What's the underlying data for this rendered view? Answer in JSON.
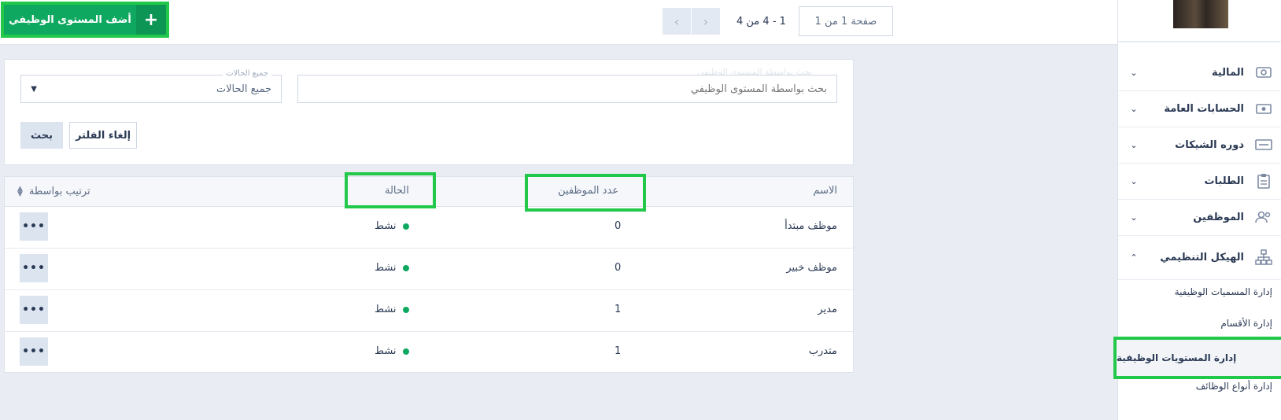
{
  "header": {
    "add_button_label": "أضف المستوى الوظيفي",
    "add_button_icon": "+",
    "pager": {
      "range_text": "1 - 4 من 4",
      "page_box_text": "صفحة 1 من 1",
      "prev_glyph": "‹",
      "next_glyph": "›"
    }
  },
  "filters": {
    "search_placeholder": "بحث بواسطة المستوى الوظيفي",
    "status_legend": "جميع الحالات",
    "status_value": "جميع الحالات",
    "search_button": "بحث",
    "clear_button": "إلغاء الفلتر"
  },
  "table": {
    "headers": {
      "name": "الاسم",
      "employees": "عدد الموظفين",
      "status": "الحالة",
      "sort": "ترتيب بواسطة"
    },
    "rows": [
      {
        "name": "موظف مبتدأ",
        "employees": "0",
        "status": "نشط"
      },
      {
        "name": "موظف خبير",
        "employees": "0",
        "status": "نشط"
      },
      {
        "name": "مدير",
        "employees": "1",
        "status": "نشط"
      },
      {
        "name": "متدرب",
        "employees": "1",
        "status": "نشط"
      }
    ],
    "more_glyph": "•••"
  },
  "sidebar": {
    "items": [
      {
        "label": "المالية",
        "icon": "money-icon",
        "chevron": "⌄"
      },
      {
        "label": "الحسابات العامة",
        "icon": "cash-icon",
        "chevron": "⌄"
      },
      {
        "label": "دوره الشيكات",
        "icon": "cheque-icon",
        "chevron": "⌄"
      },
      {
        "label": "الطلبات",
        "icon": "clipboard-icon",
        "chevron": "⌄"
      },
      {
        "label": "الموظفين",
        "icon": "users-icon",
        "chevron": "⌄"
      },
      {
        "label": "الهيكل التنظيمي",
        "icon": "org-chart-icon",
        "chevron": "⌃"
      }
    ],
    "sub_items": [
      {
        "label": "إدارة المسميات الوظيفية"
      },
      {
        "label": "إدارة الأقسام"
      },
      {
        "label": "إدارة المستويات الوظيفية"
      },
      {
        "label": "إدارة أنواع الوظائف"
      }
    ]
  },
  "colors": {
    "accent_green": "#0fa860",
    "highlight": "#22c84a",
    "text": "#2b3a55"
  }
}
